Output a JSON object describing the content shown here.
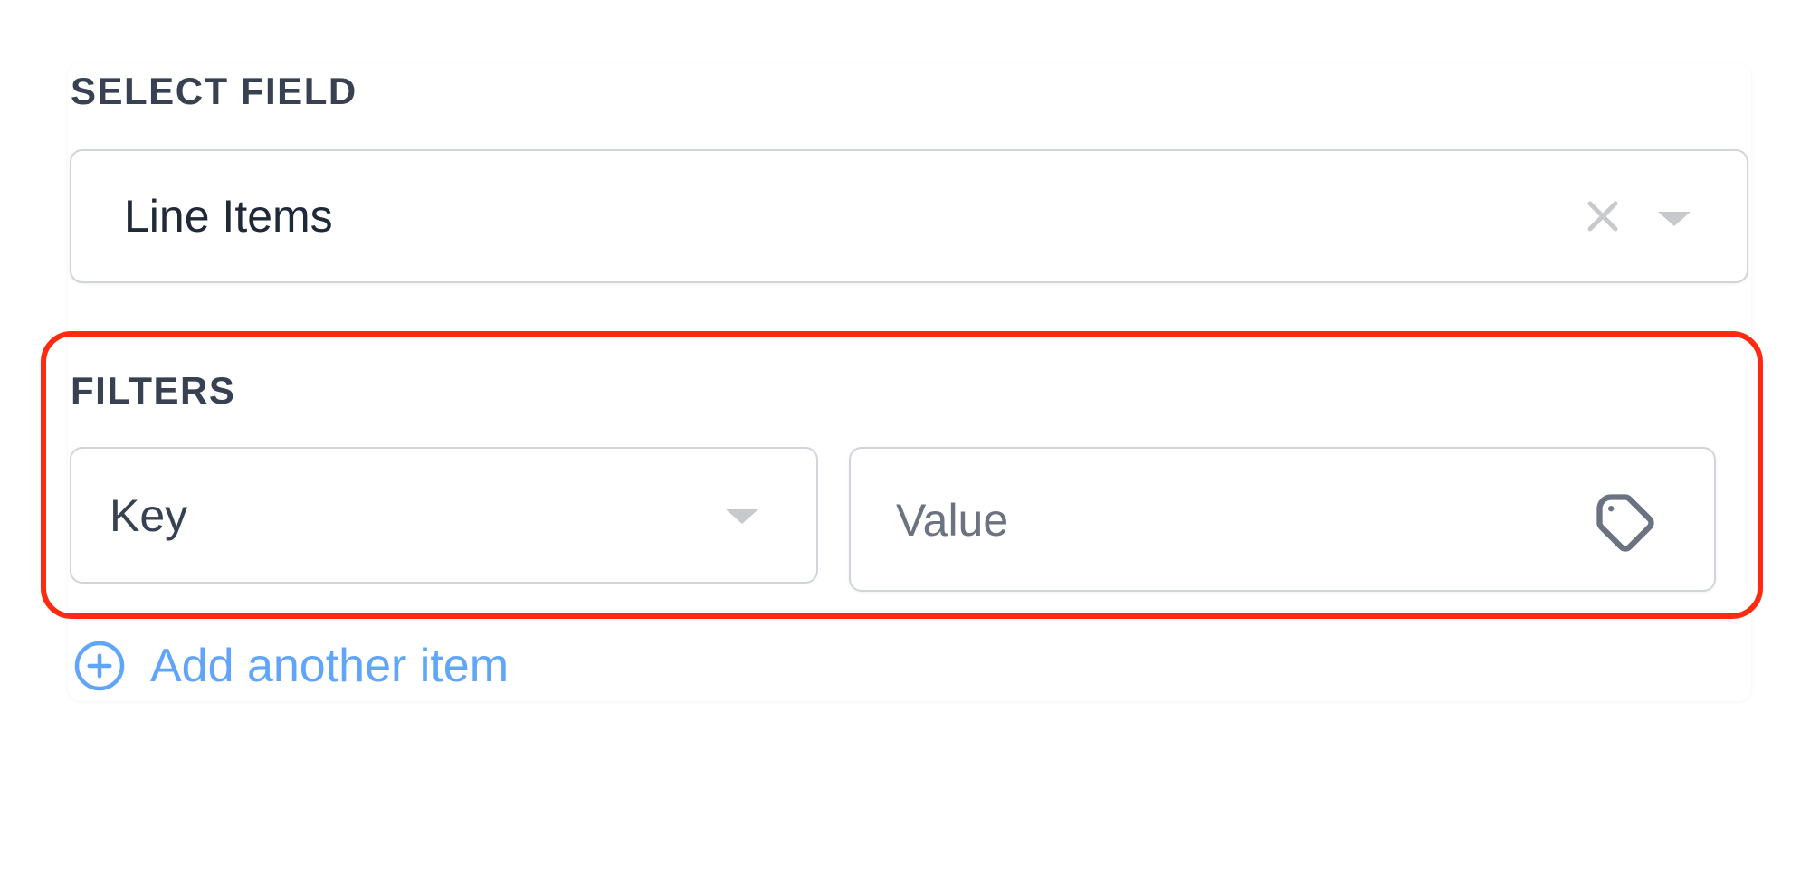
{
  "select_field": {
    "label": "SELECT FIELD",
    "value": "Line Items",
    "clear_icon": "close-icon",
    "dropdown_icon": "chevron-down-icon"
  },
  "filters": {
    "label": "FILTERS",
    "key_placeholder": "Key",
    "key_dropdown_icon": "chevron-down-icon",
    "value_placeholder": "Value",
    "value_icon": "tag-icon"
  },
  "add_item": {
    "label": "Add another item",
    "icon": "plus-circle-icon"
  },
  "colors": {
    "label": "#374151",
    "border": "#d1d5db",
    "highlight": "#ff2a10",
    "link": "#60a5fa"
  }
}
